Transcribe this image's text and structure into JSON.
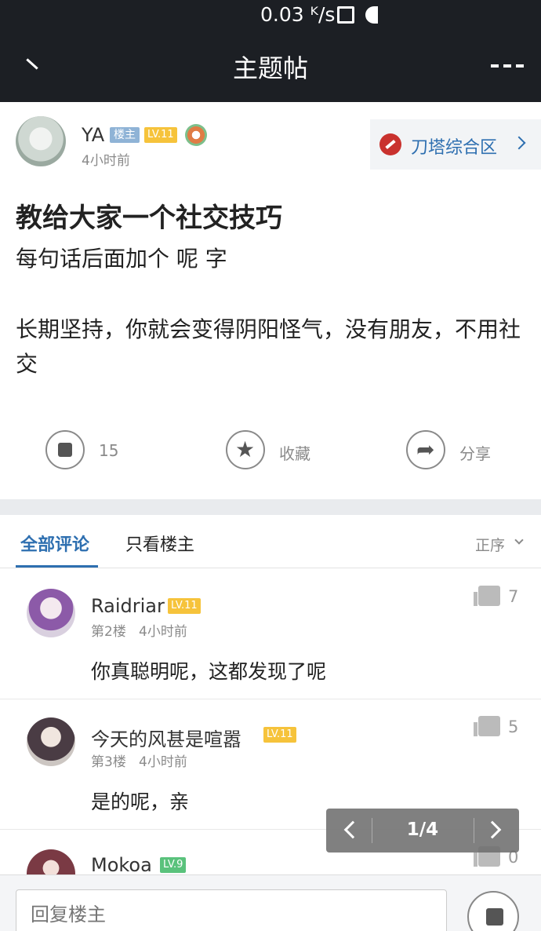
{
  "status": {
    "speed": "0.03 ᴷ/s"
  },
  "titlebar": {
    "title": "主题帖"
  },
  "post": {
    "author": "YA",
    "owner_badge": "楼主",
    "level": "LV.11",
    "time": "4小时前",
    "forum": "刀塔综合区",
    "title": "教给大家一个社交技巧",
    "lines": [
      "每句话后面加个 呢 字",
      "长期坚持，你就会变得阴阳怪气，没有朋友，不用社交"
    ],
    "like_count": "15",
    "favorite_label": "收藏",
    "share_label": "分享"
  },
  "tabs": {
    "all": "全部评论",
    "owner_only": "只看楼主",
    "sort": "正序"
  },
  "comments": [
    {
      "name": "Raidriar",
      "level": "LV.11",
      "floor": "第2楼",
      "time": "4小时前",
      "text": "你真聪明呢，这都发现了呢",
      "likes": "7"
    },
    {
      "name": "今天的风甚是喧嚣",
      "level": "LV.11",
      "floor": "第3楼",
      "time": "4小时前",
      "text": "是的呢，亲",
      "likes": "5"
    },
    {
      "name": "Mokoa",
      "level": "LV.9",
      "likes": "0"
    }
  ],
  "pager": {
    "label": "1/4"
  },
  "reply": {
    "placeholder": "回复楼主"
  },
  "colors": {
    "accent": "#2e6fb0",
    "header_bg": "#1c1f24",
    "level_badge": "#f6c33b"
  }
}
